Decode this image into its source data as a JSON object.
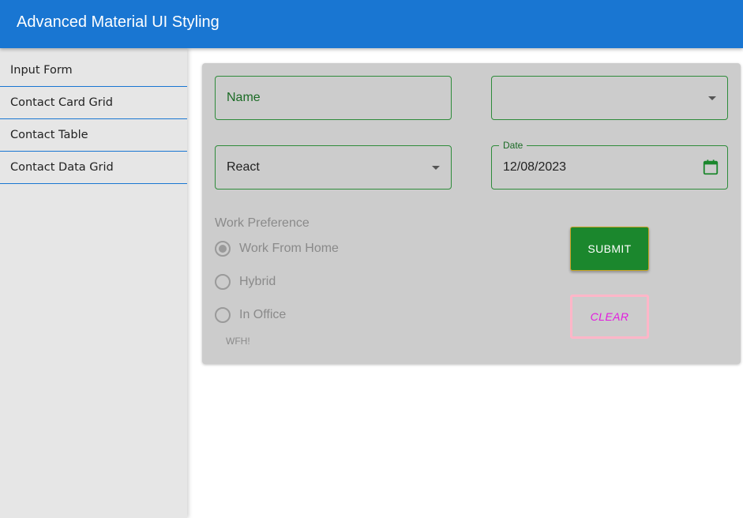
{
  "app": {
    "title": "Advanced Material UI Styling"
  },
  "sidebar": {
    "items": [
      {
        "label": "Input Form"
      },
      {
        "label": "Contact Card Grid"
      },
      {
        "label": "Contact Table"
      },
      {
        "label": "Contact Data Grid"
      }
    ]
  },
  "form": {
    "name_field": {
      "value": "Name"
    },
    "top_select": {
      "value": ""
    },
    "skill_select": {
      "value": "React"
    },
    "date_field": {
      "label": "Date",
      "value": "12/08/2023"
    },
    "work_preference": {
      "label": "Work Preference",
      "options": [
        {
          "label": "Work From Home",
          "checked": true
        },
        {
          "label": "Hybrid",
          "checked": false
        },
        {
          "label": "In Office",
          "checked": false
        }
      ],
      "helper": "WFH!"
    },
    "submit_label": "SUBMIT",
    "clear_label": "CLEAR"
  },
  "colors": {
    "appbar": "#1976d2",
    "submit": "#1b872d",
    "clear_text": "#e21adf",
    "clear_border": "#ffb6c8",
    "field_border": "#2e8b3a"
  }
}
